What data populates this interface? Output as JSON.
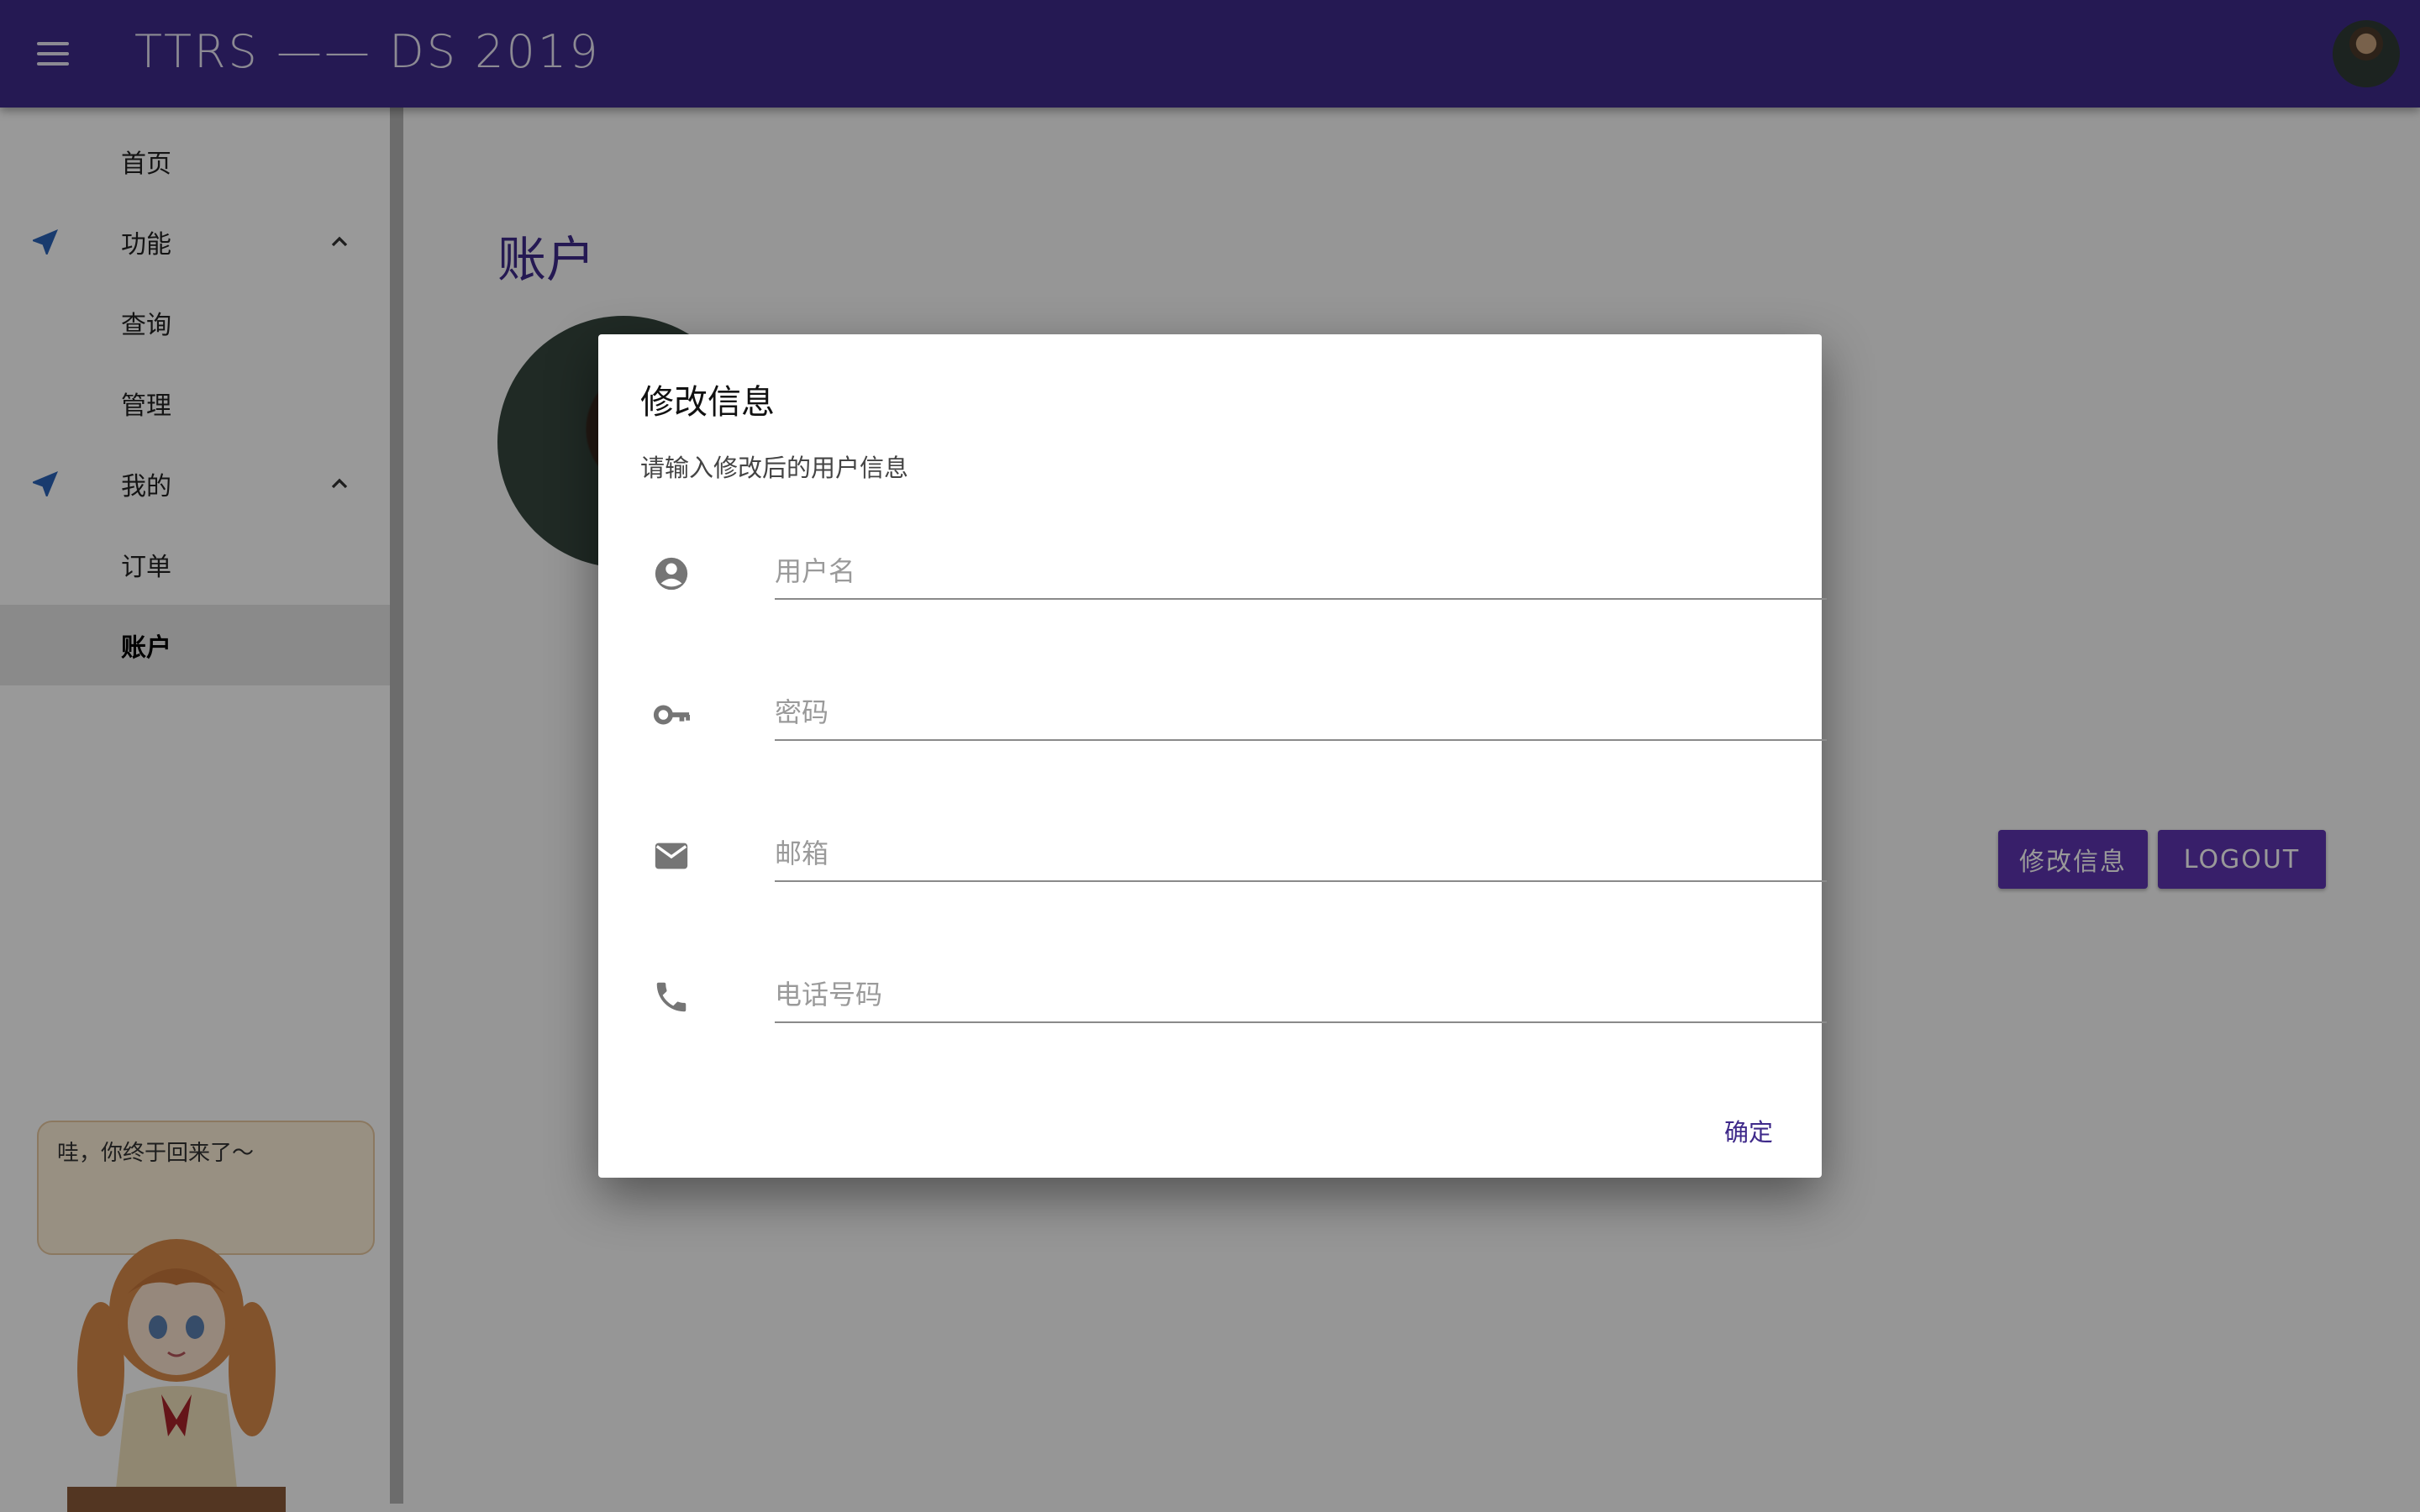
{
  "app": {
    "title": "TTRS —— DS 2019"
  },
  "sidebar": {
    "items": [
      {
        "label": "首页"
      },
      {
        "label": "功能"
      },
      {
        "label": "查询"
      },
      {
        "label": "管理"
      },
      {
        "label": "我的"
      },
      {
        "label": "订单"
      },
      {
        "label": "账户"
      }
    ]
  },
  "main": {
    "title": "账户",
    "edit_button": "修改信息",
    "logout_button": "LOGOUT"
  },
  "dialog": {
    "title": "修改信息",
    "subtitle": "请输入修改后的用户信息",
    "fields": [
      {
        "placeholder": "用户名",
        "icon": "account-circle-icon"
      },
      {
        "placeholder": "密码",
        "icon": "key-icon"
      },
      {
        "placeholder": "邮箱",
        "icon": "email-icon"
      },
      {
        "placeholder": "电话号码",
        "icon": "phone-icon"
      }
    ],
    "confirm": "确定"
  },
  "widget": {
    "message": "哇，你终于回来了～"
  },
  "colors": {
    "primary": "#3f2a8a",
    "button": "#5e35b1",
    "nav_icon": "#2b63b8"
  }
}
